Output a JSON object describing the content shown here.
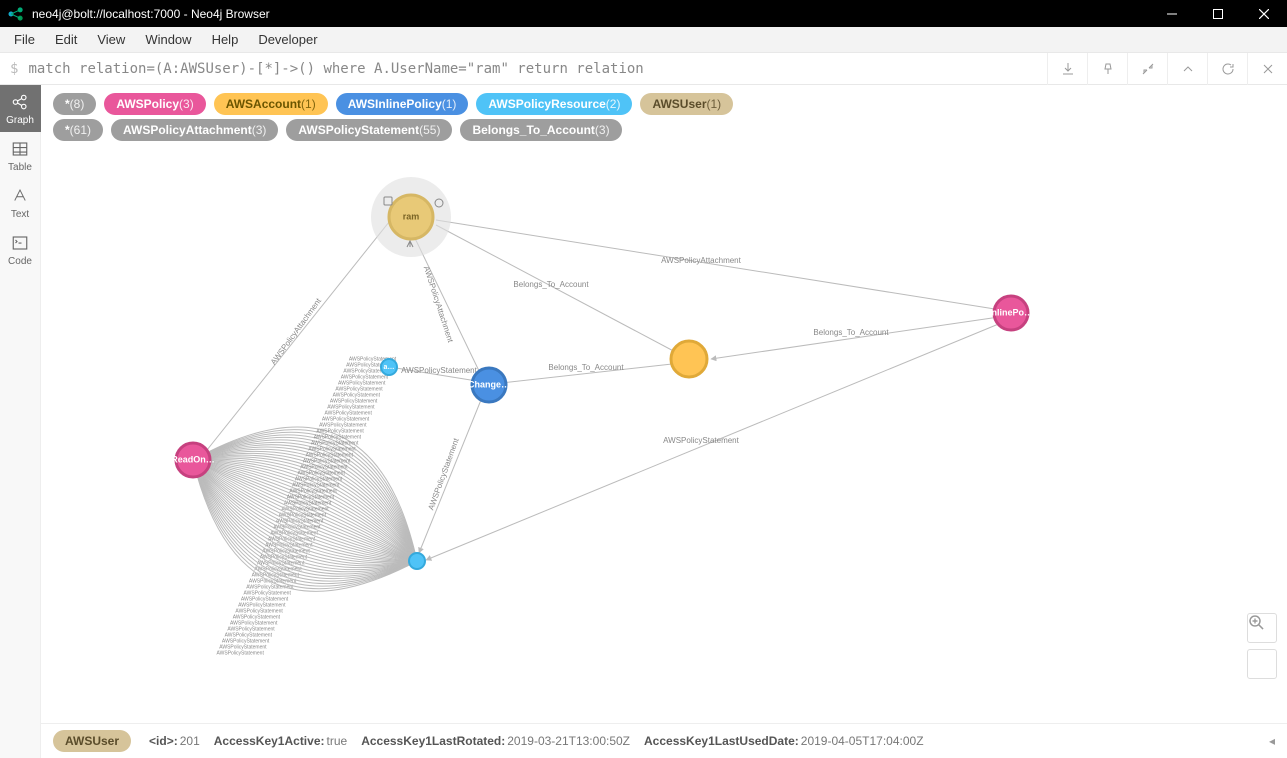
{
  "window": {
    "title": "neo4j@bolt://localhost:7000 - Neo4j Browser"
  },
  "menubar": [
    "File",
    "Edit",
    "View",
    "Window",
    "Help",
    "Developer"
  ],
  "editor": {
    "prompt": "$",
    "query": "match relation=(A:AWSUser)-[*]->() where A.UserName=\"ram\" return relation"
  },
  "sidebar": {
    "items": [
      {
        "label": "Graph"
      },
      {
        "label": "Table"
      },
      {
        "label": "Text"
      },
      {
        "label": "Code"
      }
    ]
  },
  "legend": {
    "nodes": [
      {
        "label": "*",
        "count": "(8)",
        "cls": "gray"
      },
      {
        "label": "AWSPolicy",
        "count": "(3)",
        "cls": "pink"
      },
      {
        "label": "AWSAccount",
        "count": "(1)",
        "cls": "orange"
      },
      {
        "label": "AWSInlinePolicy",
        "count": "(1)",
        "cls": "blue"
      },
      {
        "label": "AWSPolicyResource",
        "count": "(2)",
        "cls": "teal"
      },
      {
        "label": "AWSUser",
        "count": "(1)",
        "cls": "tan"
      }
    ],
    "rels": [
      {
        "label": "*",
        "count": "(61)",
        "cls": "gray"
      },
      {
        "label": "AWSPolicyAttachment",
        "count": "(3)",
        "cls": "gray"
      },
      {
        "label": "AWSPolicyStatement",
        "count": "(55)",
        "cls": "gray"
      },
      {
        "label": "Belongs_To_Account",
        "count": "(3)",
        "cls": "gray"
      }
    ]
  },
  "graph": {
    "nodes": {
      "ram": {
        "label": "ram",
        "color": "#e8c977",
        "ring": "#d6c49a"
      },
      "account": {
        "label": "",
        "color": "#ffc454"
      },
      "change": {
        "label": "Change…",
        "color": "#4a90e2"
      },
      "inline": {
        "label": "InlinePo…",
        "color": "#e9579b"
      },
      "readon": {
        "label": "ReadOn…",
        "color": "#e9579b"
      },
      "res1": {
        "label": "a…",
        "color": "#4fc3f7"
      },
      "res2": {
        "label": "",
        "color": "#4fc3f7"
      }
    },
    "edges": {
      "e1": "AWSPolicyAttachment",
      "e2": "Belongs_To_Account",
      "e3": "Belongs_To_Account",
      "e4": "Belongs_To_Account",
      "e5": "AWSPolicyStatement",
      "e6": "AWSPolicyAttachment",
      "e7": "AWSPolicyStatement",
      "e8": "AWSPolicyAttachment",
      "e9": "AWSPolicyStatement"
    }
  },
  "inspector": {
    "type": "AWSUser",
    "props": [
      {
        "k": "<id>:",
        "v": "201"
      },
      {
        "k": "AccessKey1Active:",
        "v": "true"
      },
      {
        "k": "AccessKey1LastRotated:",
        "v": "2019-03-21T13:00:50Z"
      },
      {
        "k": "AccessKey1LastUsedDate:",
        "v": "2019-04-05T17:04:00Z"
      }
    ]
  }
}
